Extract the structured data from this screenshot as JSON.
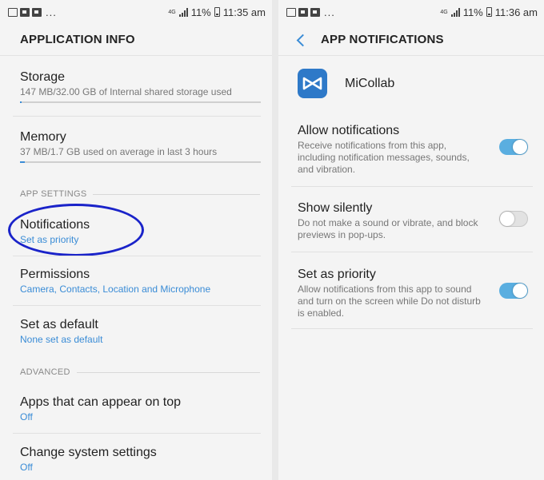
{
  "left_screen": {
    "status_bar": {
      "notif_more": "...",
      "network": "4G",
      "battery_percent": "11%",
      "time": "11:35 am"
    },
    "title": "APPLICATION INFO",
    "storage": {
      "title": "Storage",
      "subtitle": "147 MB/32.00 GB of Internal shared storage used",
      "usage_fraction": 0.005
    },
    "memory": {
      "title": "Memory",
      "subtitle": "37 MB/1.7 GB used on average in last 3 hours",
      "usage_fraction": 0.02
    },
    "app_settings_label": "APP SETTINGS",
    "notifications": {
      "title": "Notifications",
      "subtitle": "Set as priority"
    },
    "permissions": {
      "title": "Permissions",
      "subtitle": "Camera, Contacts, Location and Microphone"
    },
    "set_default": {
      "title": "Set as default",
      "subtitle": "None set as default"
    },
    "advanced_label": "ADVANCED",
    "appear_on_top": {
      "title": "Apps that can appear on top",
      "subtitle": "Off"
    },
    "system_settings": {
      "title": "Change system settings",
      "subtitle": "Off"
    }
  },
  "right_screen": {
    "status_bar": {
      "notif_more": "...",
      "network": "4G",
      "battery_percent": "11%",
      "time": "11:36 am"
    },
    "title": "APP NOTIFICATIONS",
    "app_name": "MiCollab",
    "allow": {
      "title": "Allow notifications",
      "subtitle": "Receive notifications from this app, including notification messages, sounds, and vibration.",
      "enabled": true
    },
    "silent": {
      "title": "Show silently",
      "subtitle": "Do not make a sound or vibrate, and block previews in pop-ups.",
      "enabled": false
    },
    "priority": {
      "title": "Set as priority",
      "subtitle": "Allow notifications from this app to sound and turn on the screen while Do not disturb is enabled.",
      "enabled": true
    }
  },
  "colors": {
    "accent": "#3a8cd6",
    "toggle_on": "#5aaee0",
    "highlight_circle": "#1a23c9",
    "app_icon_bg": "#2e79c8"
  }
}
